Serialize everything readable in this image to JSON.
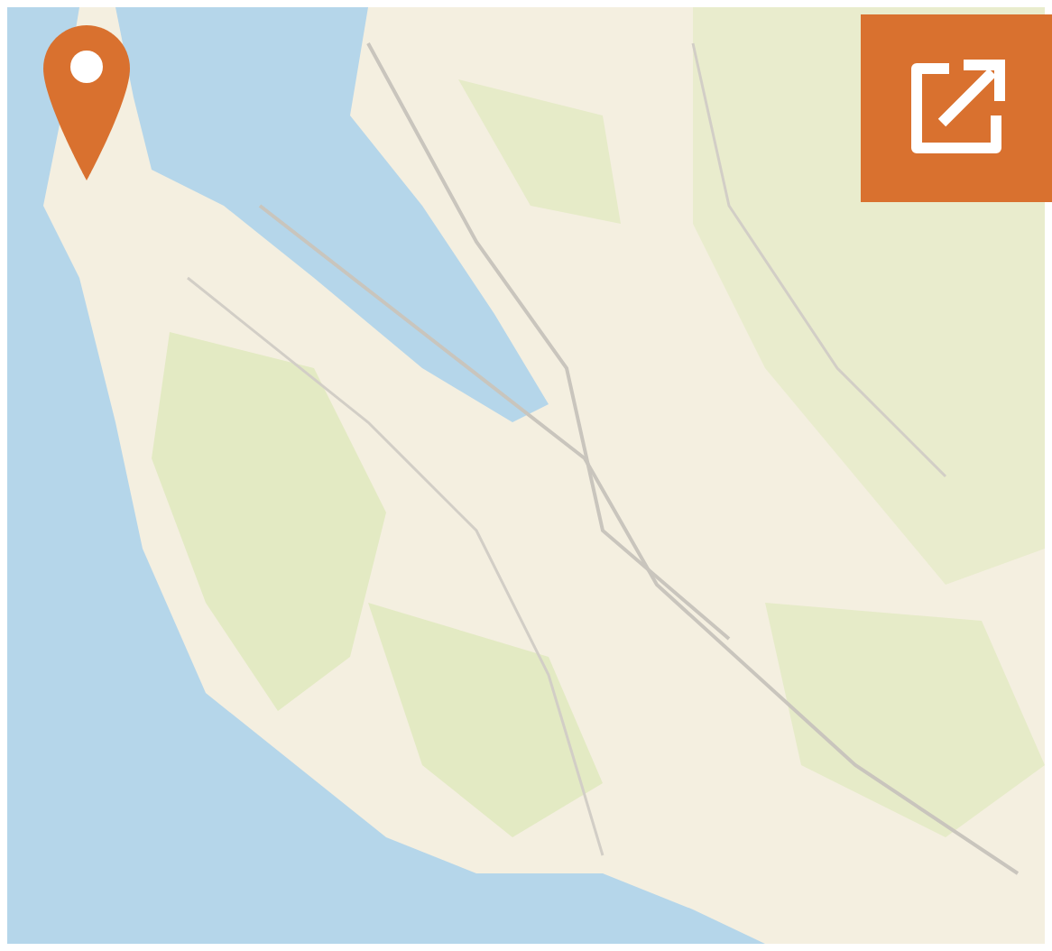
{
  "map": {
    "kind": "picture",
    "pin": true
  },
  "open_button": {
    "kind": "external-link"
  }
}
